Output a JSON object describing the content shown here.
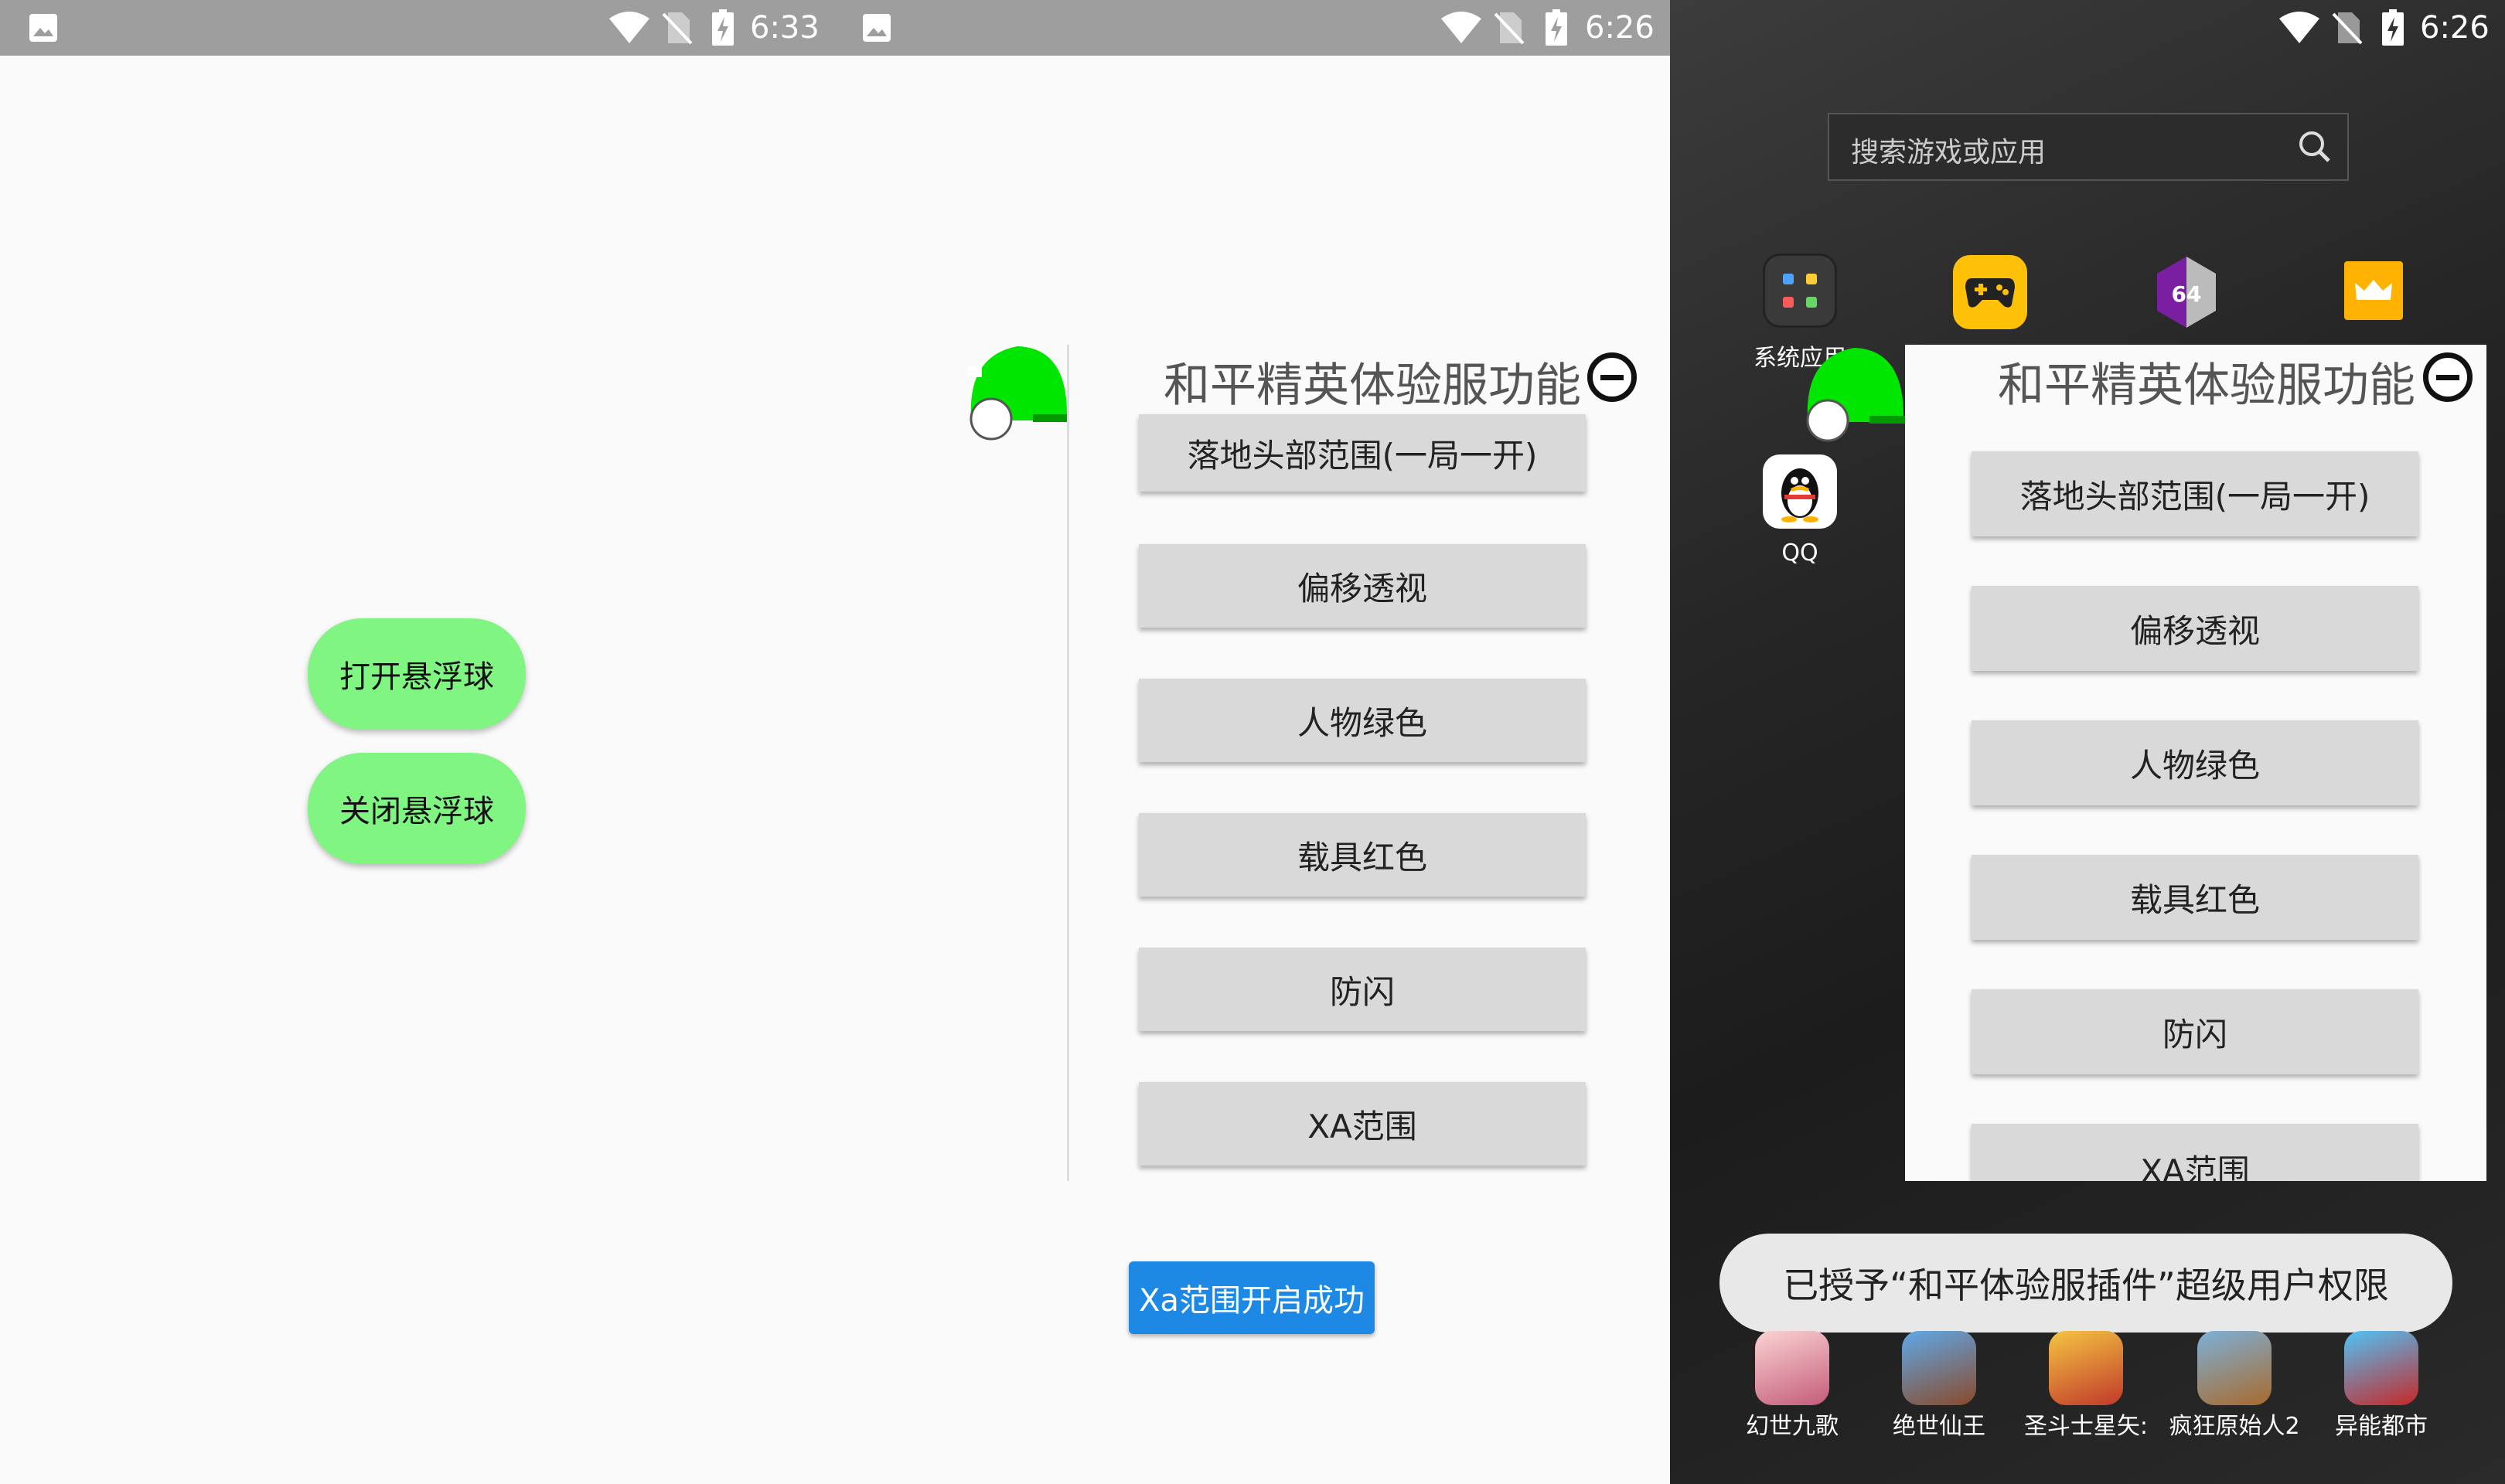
{
  "left": {
    "status_time_1": "6:33",
    "status_time_2": "6:26",
    "open_float_button": "打开悬浮球",
    "close_float_button": "关闭悬浮球",
    "menu_title": "和平精英体验服功能",
    "menu_items": [
      "落地头部范围(一局一开)",
      "偏移透视",
      "人物绿色",
      "载具红色",
      "防闪",
      "XA范围"
    ],
    "toast": "Xa范围开启成功"
  },
  "right": {
    "status_time": "6:26",
    "search_placeholder": "搜索游戏或应用",
    "apps_top": [
      {
        "label": "系统应用",
        "icon": "folder-icon"
      },
      {
        "label": "",
        "icon": "gamepad-icon"
      },
      {
        "label": "",
        "icon": "gg64-icon"
      },
      {
        "label": "",
        "icon": "crown-icon"
      }
    ],
    "qq_label": "QQ",
    "menu_title": "和平精英体验服功能",
    "menu_items": [
      "落地头部范围(一局一开)",
      "偏移透视",
      "人物绿色",
      "载具红色",
      "防闪",
      "XA范围"
    ],
    "toast": "已授予“和平体验服插件”超级用户权限",
    "dock_apps": [
      "幻世九歌",
      "绝世仙王",
      "圣斗士星矢:",
      "疯狂原始人2",
      "异能都市"
    ]
  },
  "colors": {
    "float_ball": "#00e600",
    "pill_button": "#80f582",
    "toast_blue": "#1e88e5",
    "menu_button": "#d9d9d9"
  }
}
